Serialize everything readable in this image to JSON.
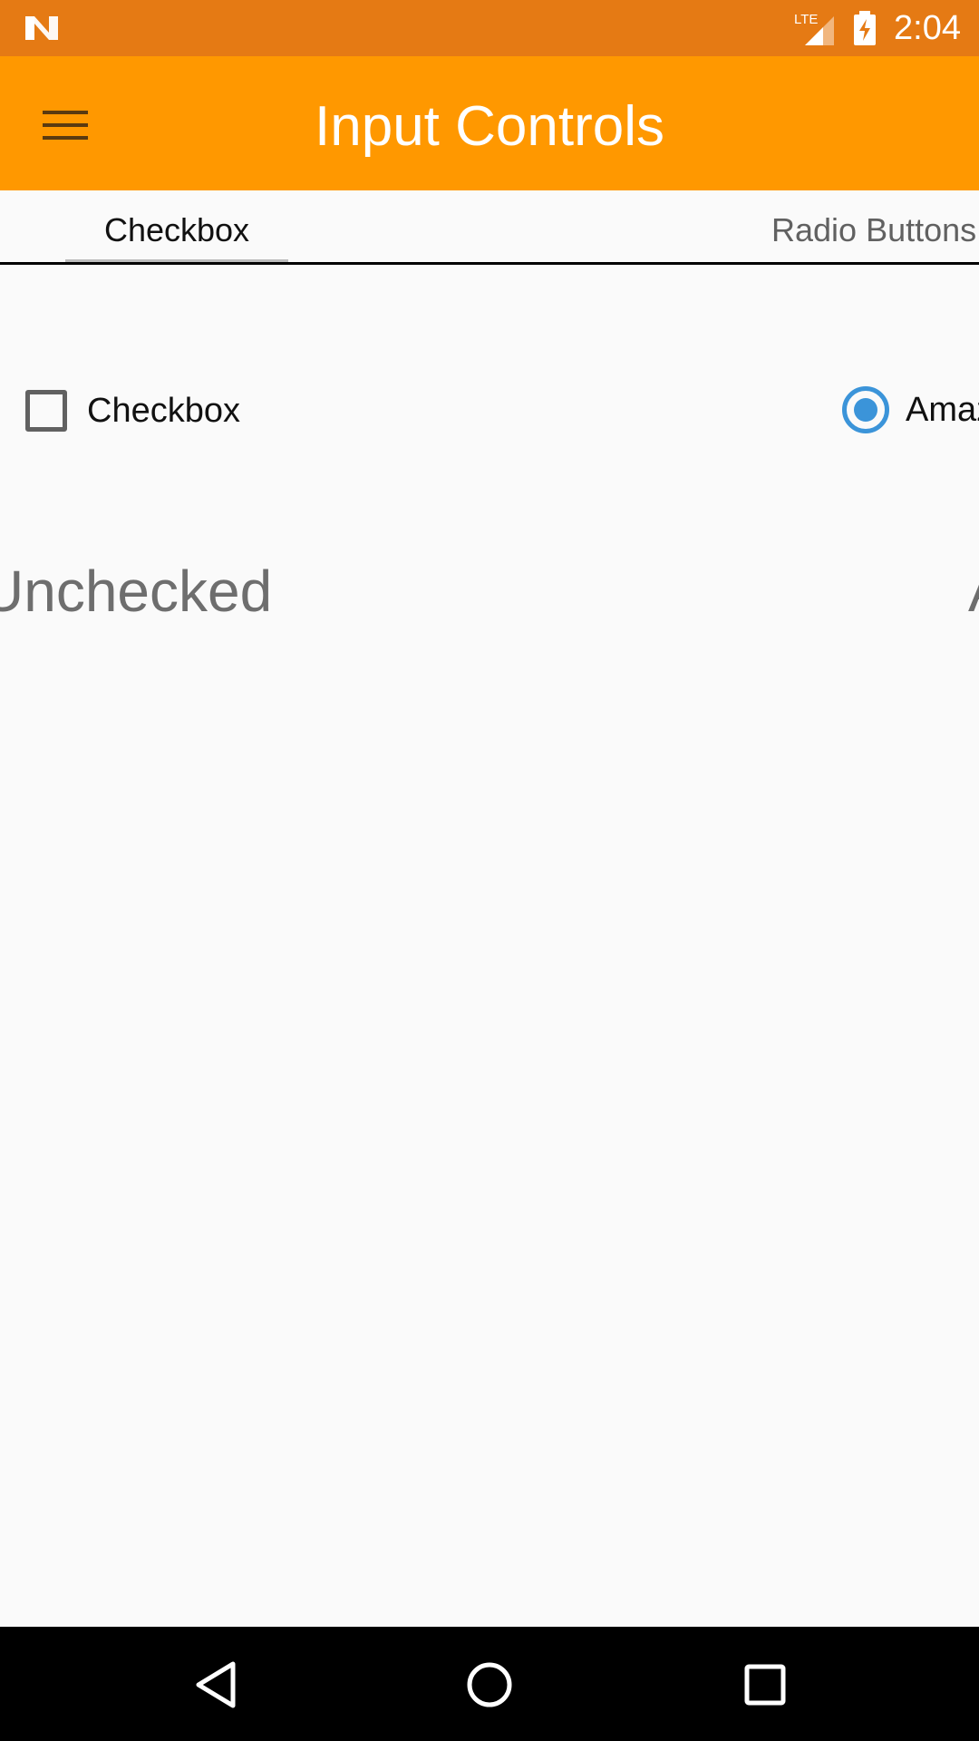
{
  "status_bar": {
    "time": "2:04",
    "network": "LTE",
    "background_color": "#e57a14"
  },
  "app_bar": {
    "title": "Input Controls",
    "menu_icon": "hamburger-menu-icon",
    "background_color": "#ff9800"
  },
  "tabs": [
    {
      "label": "Checkbox",
      "selected": true
    },
    {
      "label": "Radio Buttons",
      "selected": false
    }
  ],
  "checkbox": {
    "label": "Checkbox",
    "checked": false
  },
  "radio": {
    "label": "Amaz",
    "selected": true,
    "accent_color": "#3b94d9"
  },
  "status": {
    "left_text": "Unchecked",
    "right_text": "A"
  },
  "nav_bar": {
    "back_icon": "back-triangle-icon",
    "home_icon": "home-circle-icon",
    "recent_icon": "recent-apps-square-icon"
  }
}
